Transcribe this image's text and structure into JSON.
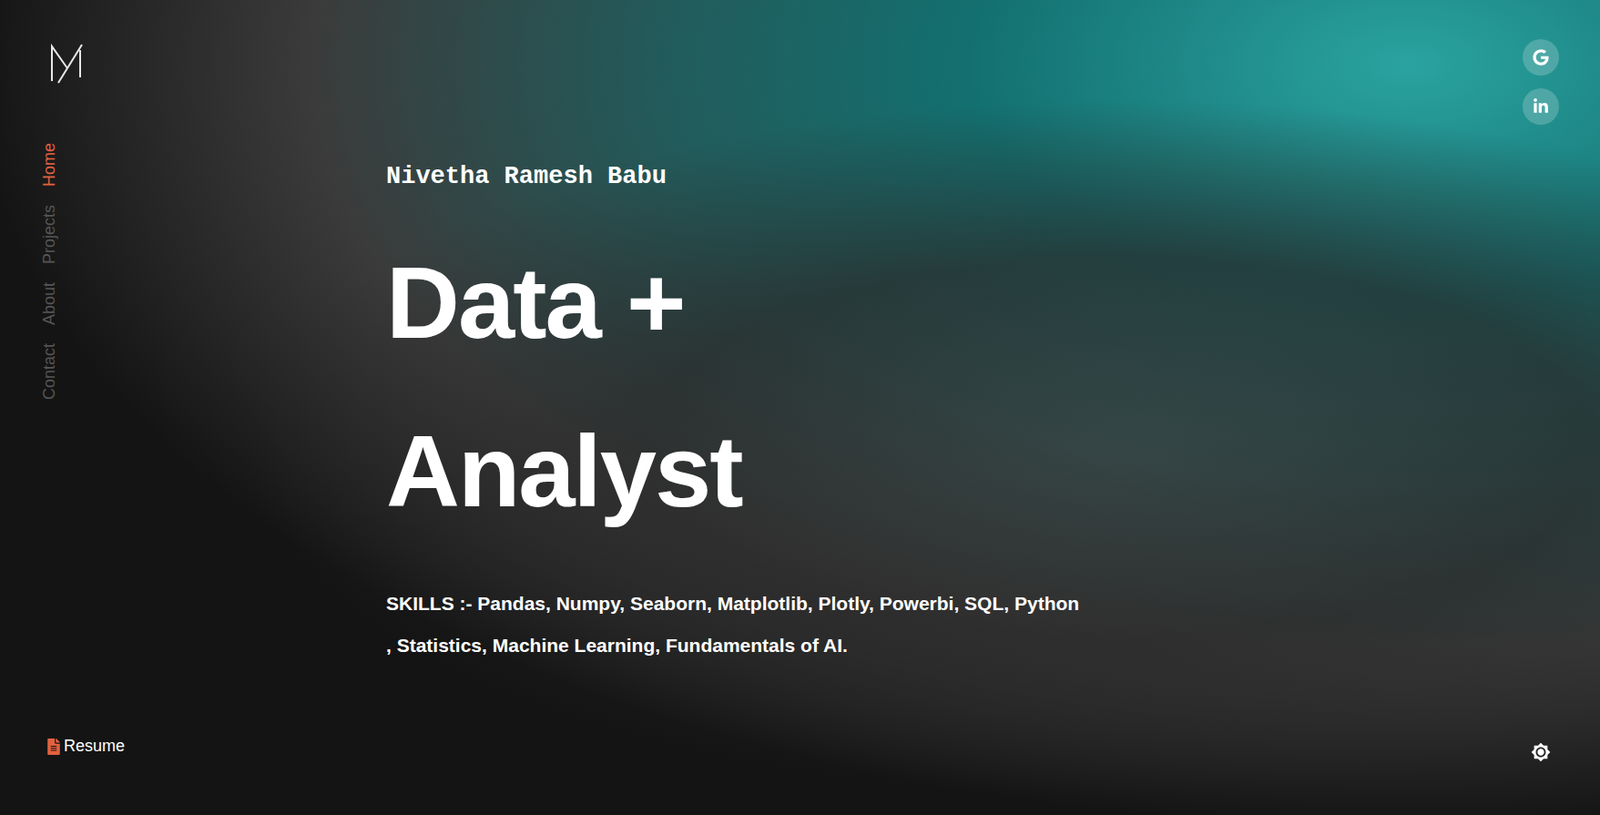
{
  "nav": {
    "items": [
      {
        "label": "Home",
        "selected": true
      },
      {
        "label": "Projects",
        "selected": false
      },
      {
        "label": "About",
        "selected": false
      },
      {
        "label": "Contact",
        "selected": false
      }
    ]
  },
  "resume": {
    "label": "Resume"
  },
  "hero": {
    "name": "Nivetha Ramesh Babu",
    "title_lines": [
      "Data +",
      "Analyst"
    ],
    "skills_lines": [
      "SKILLS :- Pandas, Numpy, Seaborn, Matplotlib, Plotly, Powerbi, SQL, Python",
      ", Statistics, Machine Learning, Fundamentals of AI."
    ]
  }
}
